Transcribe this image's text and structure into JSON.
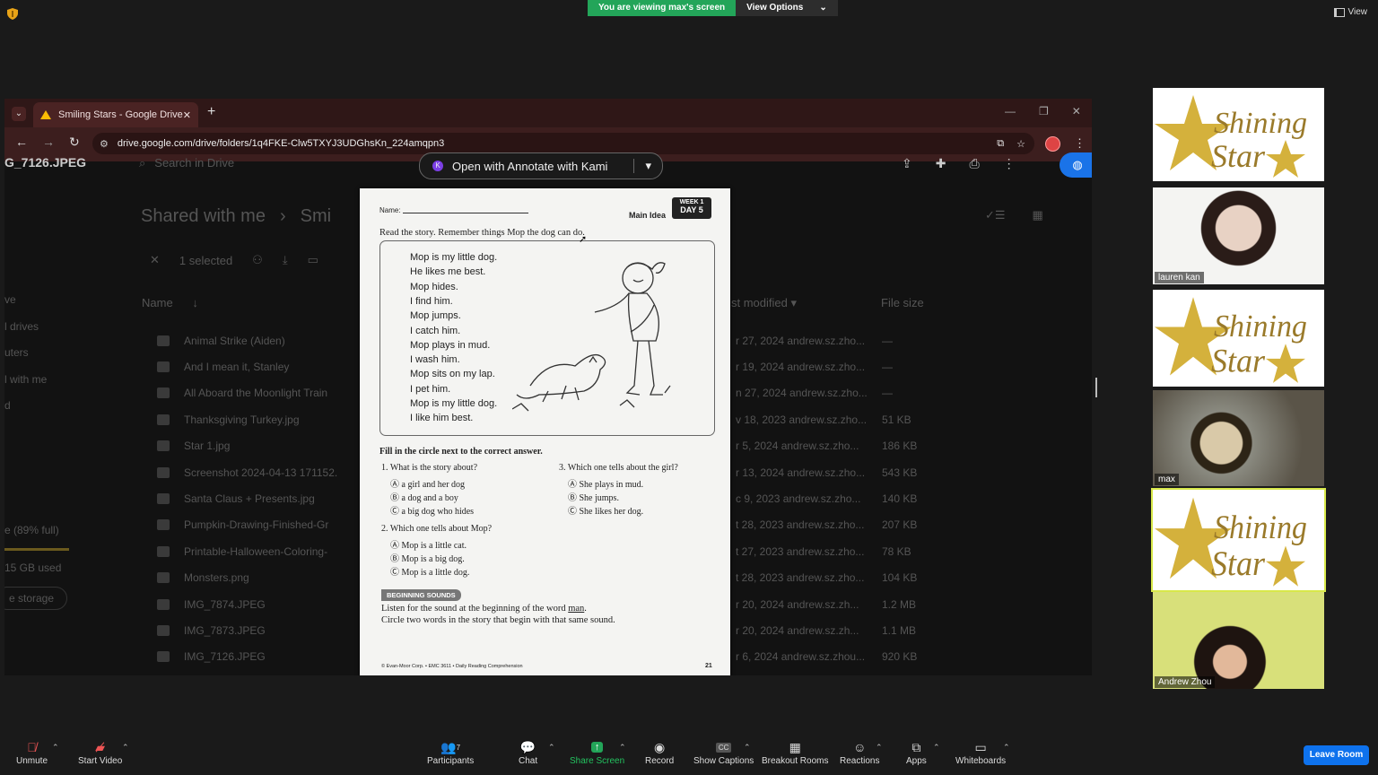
{
  "zoom": {
    "banner_text": "You are viewing max's screen",
    "view_options": "View Options",
    "view_button": "View"
  },
  "browser": {
    "tab_title": "Smiling Stars - Google Drive",
    "url": "drive.google.com/drive/folders/1q4FKE-Clw5TXYJ3UDGhsKn_224amqpn3",
    "kami_button": "Open with Annotate with Kami"
  },
  "drive": {
    "filename": "G_7126.JPEG",
    "search_placeholder": "Search in Drive",
    "breadcrumb_root": "Shared with me",
    "breadcrumb_child": "Smi",
    "selected": "1 selected",
    "col_name": "Name",
    "col_modified": "st modified",
    "col_size": "File size",
    "sidebar": [
      "ve",
      "l drives",
      "uters",
      "l with me",
      "",
      "d"
    ],
    "storage_text": "e (89% full)",
    "storage_used": "15 GB used",
    "storage_button": "e storage",
    "files": [
      {
        "name": "Animal Strike (Aiden)",
        "modified": "r 27, 2024 andrew.sz.zho...",
        "size": "—"
      },
      {
        "name": "And I mean it, Stanley",
        "modified": "r 19, 2024 andrew.sz.zho...",
        "size": "—"
      },
      {
        "name": "All Aboard the Moonlight Train",
        "modified": "n 27, 2024 andrew.sz.zho...",
        "size": "—"
      },
      {
        "name": "Thanksgiving Turkey.jpg",
        "modified": "v 18, 2023 andrew.sz.zho...",
        "size": "51 KB"
      },
      {
        "name": "Star 1.jpg",
        "modified": "r 5, 2024 andrew.sz.zho...",
        "size": "186 KB"
      },
      {
        "name": "Screenshot 2024-04-13 171152.",
        "modified": "r 13, 2024 andrew.sz.zho...",
        "size": "543 KB"
      },
      {
        "name": "Santa Claus + Presents.jpg",
        "modified": "c 9, 2023 andrew.sz.zho...",
        "size": "140 KB"
      },
      {
        "name": "Pumpkin-Drawing-Finished-Gr",
        "modified": "t 28, 2023 andrew.sz.zho...",
        "size": "207 KB"
      },
      {
        "name": "Printable-Halloween-Coloring-",
        "modified": "t 27, 2023 andrew.sz.zho...",
        "size": "78 KB"
      },
      {
        "name": "Monsters.png",
        "modified": "t 28, 2023 andrew.sz.zho...",
        "size": "104 KB"
      },
      {
        "name": "IMG_7874.JPEG",
        "modified": "r 20, 2024 andrew.sz.zh...",
        "size": "1.2 MB"
      },
      {
        "name": "IMG_7873.JPEG",
        "modified": "r 20, 2024 andrew.sz.zh...",
        "size": "1.1 MB"
      },
      {
        "name": "IMG_7126.JPEG",
        "modified": "r 6, 2024 andrew.sz.zhou...",
        "size": "920 KB"
      }
    ]
  },
  "worksheet": {
    "name_label": "Name:",
    "skill": "Main Idea",
    "week": "WEEK 1",
    "day": "DAY 5",
    "instructions": "Read the story. Remember things Mop the dog can do.",
    "poem": [
      "Mop is my little dog.",
      "He likes me best.",
      "Mop hides.",
      "I find him.",
      "Mop jumps.",
      "I catch him.",
      "Mop plays in mud.",
      "I wash him.",
      "Mop sits on my lap.",
      "I pet him.",
      "Mop is my little dog.",
      "I like him best."
    ],
    "fill_instructions": "Fill in the circle next to the correct answer.",
    "q1": "1. What is the story about?",
    "q1_options": [
      "Ⓐ a girl and her dog",
      "Ⓑ a dog and a boy",
      "Ⓒ a big dog who hides"
    ],
    "q2": "2. Which one tells about Mop?",
    "q2_options": [
      "Ⓐ Mop is a little cat.",
      "Ⓑ Mop is a big dog.",
      "Ⓒ Mop is a little dog."
    ],
    "q3": "3. Which one tells about the girl?",
    "q3_options": [
      "Ⓐ She plays in mud.",
      "Ⓑ She jumps.",
      "Ⓒ She likes her dog."
    ],
    "section": "BEGINNING SOUNDS",
    "bs_line1_a": "Listen for the sound at the beginning of the word ",
    "bs_word": "man",
    "bs_line1_b": ".",
    "bs_line2": "Circle two words in the story that begin with that same sound.",
    "footer": "© Evan-Moor Corp. • EMC 3611 • Daily Reading Comprehension",
    "page": "21"
  },
  "participants": [
    {
      "type": "logo",
      "logo_line1": "Shining",
      "logo_line2": "Star"
    },
    {
      "type": "video",
      "name": "lauren kan"
    },
    {
      "type": "logo",
      "logo_line1": "Shining",
      "logo_line2": "Star"
    },
    {
      "type": "video",
      "name": "max"
    },
    {
      "type": "logo",
      "logo_line1": "Shining",
      "logo_line2": "Star"
    },
    {
      "type": "video",
      "name": "Andrew Zhou"
    }
  ],
  "toolbar": {
    "unmute": "Unmute",
    "start_video": "Start Video",
    "participants": "Participants",
    "participant_count": "7",
    "chat": "Chat",
    "share_screen": "Share Screen",
    "record": "Record",
    "captions": "Show Captions",
    "breakout": "Breakout Rooms",
    "reactions": "Reactions",
    "apps": "Apps",
    "whiteboards": "Whiteboards",
    "leave": "Leave Room"
  },
  "colors": {
    "zoom_green": "#23a559",
    "leave_blue": "#0e72ed",
    "chrome_tab": "#3c1e1e",
    "gold": "#c9a227"
  }
}
